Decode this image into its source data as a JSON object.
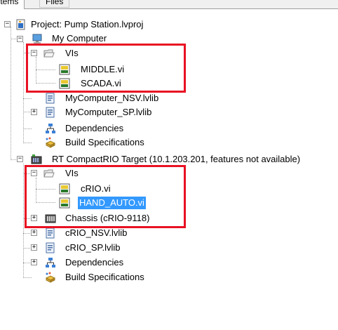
{
  "tabs": [
    {
      "label": "Items",
      "active": true
    },
    {
      "label": "Files",
      "active": false
    }
  ],
  "tree": {
    "project": "Project: Pump Station.lvproj",
    "my_computer": {
      "label": "My Computer",
      "vis_folder": "VIs",
      "vis": [
        "MIDDLE.vi",
        "SCADA.vi"
      ],
      "libs": [
        "MyComputer_NSV.lvlib",
        "MyComputer_SP.lvlib"
      ],
      "dependencies": "Dependencies",
      "build": "Build Specifications"
    },
    "target": {
      "label": "RT CompactRIO Target (10.1.203.201, features not available)",
      "vis_folder": "VIs",
      "vis": [
        "cRIO.vi",
        "HAND_AUTO.vi"
      ],
      "chassis": "Chassis (cRIO-9118)",
      "libs": [
        "cRIO_NSV.lvlib",
        "cRIO_SP.lvlib"
      ],
      "dependencies": "Dependencies",
      "build": "Build Specifications"
    }
  },
  "selected_item": "HAND_AUTO.vi",
  "colors": {
    "selection": "#3399ff",
    "highlight_box": "#e81123",
    "tree_lines": "#a0a0a0"
  }
}
